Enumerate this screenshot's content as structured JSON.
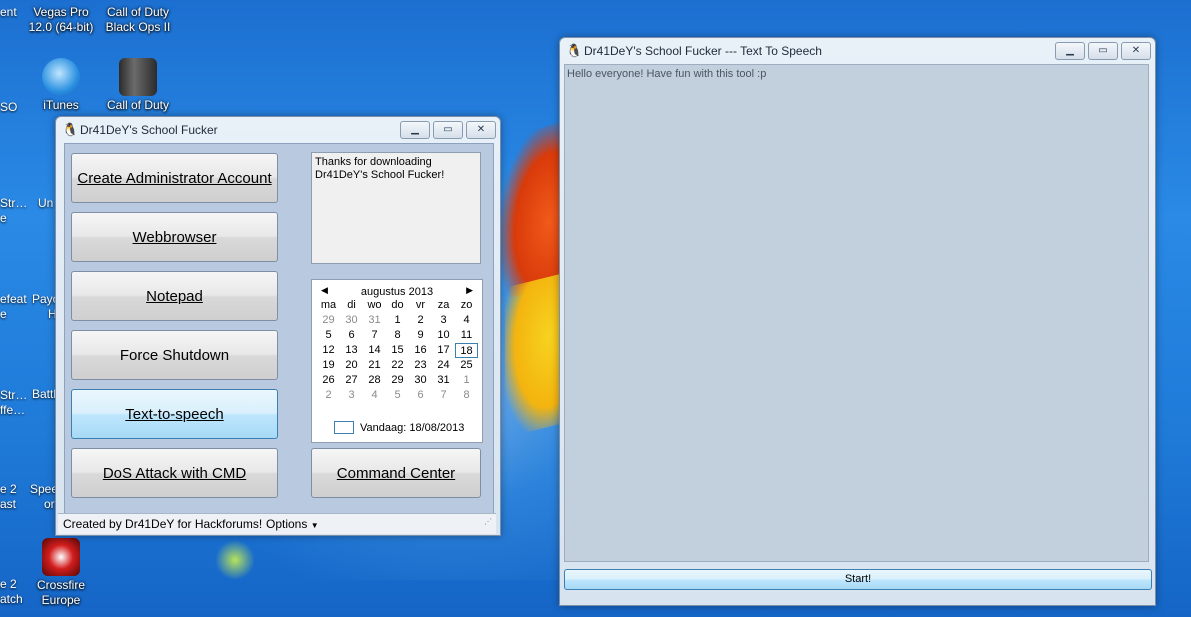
{
  "desktop": {
    "icons": [
      {
        "label_1": "Vegas Pro",
        "label_2": "12.0 (64-bit)"
      },
      {
        "label_1": "Call of Duty",
        "label_2": "Black Ops II"
      },
      {
        "label_1": "iTunes"
      },
      {
        "label_1": "Call of Duty"
      },
      {
        "label_1": "Crossfire",
        "label_2": "Europe"
      }
    ],
    "partial_labels": [
      "ent",
      "SO",
      "Str…",
      "e",
      "efeat",
      "e",
      "Str…",
      "ffe…",
      "e 2",
      "ast",
      "e 2",
      "atch",
      "Un",
      "Payo",
      "H",
      "Battl",
      "Spee",
      "or"
    ]
  },
  "main_window": {
    "title": "Dr41DeY's School Fucker",
    "buttons": {
      "create_admin": "Create Administrator Account",
      "webbrowser": "Webbrowser",
      "notepad": "Notepad",
      "force_shutdown": "Force Shutdown",
      "text_to_speech": "Text-to-speech",
      "dos_attack": "DoS Attack with CMD",
      "command_center": "Command Center"
    },
    "info_lines": [
      "Thanks for downloading",
      "Dr41DeY's School Fucker!"
    ],
    "calendar": {
      "month": "augustus 2013",
      "weekdays": [
        "ma",
        "di",
        "wo",
        "do",
        "vr",
        "za",
        "zo"
      ],
      "weeks": [
        [
          "29",
          "30",
          "31",
          "1",
          "2",
          "3",
          "4"
        ],
        [
          "5",
          "6",
          "7",
          "8",
          "9",
          "10",
          "11"
        ],
        [
          "12",
          "13",
          "14",
          "15",
          "16",
          "17",
          "18"
        ],
        [
          "19",
          "20",
          "21",
          "22",
          "23",
          "24",
          "25"
        ],
        [
          "26",
          "27",
          "28",
          "29",
          "30",
          "31",
          "1"
        ],
        [
          "2",
          "3",
          "4",
          "5",
          "6",
          "7",
          "8"
        ]
      ],
      "today_label": "Vandaag: 18/08/2013",
      "selected": "18"
    },
    "status": {
      "text": "Created by Dr41DeY for Hackforums!",
      "options": "Options"
    }
  },
  "tts_window": {
    "title": "Dr41DeY's School Fucker --- Text To Speech",
    "text": "Hello everyone! Have fun with this tool :p",
    "start": "Start!"
  },
  "icons": {
    "window_icon": "penguin-icon",
    "minimize": "minimize-icon",
    "maximize": "maximize-icon",
    "close": "close-icon"
  }
}
